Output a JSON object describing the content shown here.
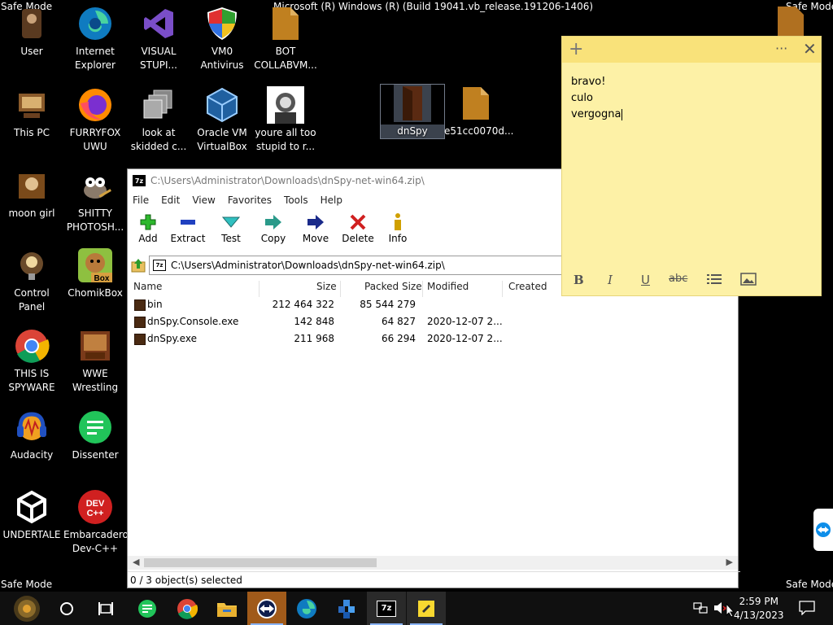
{
  "desktop": {
    "build_text": "Microsoft (R) Windows (R) (Build 19041.vb_release.191206-1406)",
    "safe_mode": "Safe Mode",
    "icons": [
      {
        "label1": "User",
        "label2": ""
      },
      {
        "label1": "Internet",
        "label2": "Explorer"
      },
      {
        "label1": "VISUAL",
        "label2": "STUPI..."
      },
      {
        "label1": "VM0",
        "label2": "Antivirus"
      },
      {
        "label1": "BOT",
        "label2": "COLLABVM..."
      },
      {
        "label1": "This PC",
        "label2": ""
      },
      {
        "label1": "FURRYFOX",
        "label2": "UWU"
      },
      {
        "label1": "look at",
        "label2": "skidded c..."
      },
      {
        "label1": "Oracle VM",
        "label2": "VirtualBox"
      },
      {
        "label1": "youre all too",
        "label2": "stupid to r..."
      },
      {
        "label1": "dnSpy",
        "label2": ""
      },
      {
        "label1": "e51cc0070d...",
        "label2": ""
      },
      {
        "label1": "moon girl",
        "label2": ""
      },
      {
        "label1": "SHITTY",
        "label2": "PHOTOSH..."
      },
      {
        "label1": "Control Panel",
        "label2": ""
      },
      {
        "label1": "ChomikBox",
        "label2": ""
      },
      {
        "label1": "THIS IS",
        "label2": "SPYWARE"
      },
      {
        "label1": "WWE",
        "label2": "Wrestling"
      },
      {
        "label1": "Audacity",
        "label2": ""
      },
      {
        "label1": "Dissenter",
        "label2": ""
      },
      {
        "label1": "UNDERTALE",
        "label2": ""
      },
      {
        "label1": "Embarcadero",
        "label2": "Dev-C++"
      }
    ]
  },
  "zip": {
    "title": "C:\\Users\\Administrator\\Downloads\\dnSpy-net-win64.zip\\",
    "menu": [
      "File",
      "Edit",
      "View",
      "Favorites",
      "Tools",
      "Help"
    ],
    "toolbar": [
      "Add",
      "Extract",
      "Test",
      "Copy",
      "Move",
      "Delete",
      "Info"
    ],
    "address": "C:\\Users\\Administrator\\Downloads\\dnSpy-net-win64.zip\\",
    "columns": {
      "name": "Name",
      "size": "Size",
      "packed": "Packed Size",
      "modified": "Modified",
      "created": "Created"
    },
    "rows": [
      {
        "name": "bin",
        "size": "212 464 322",
        "packed": "85 544 279",
        "modified": ""
      },
      {
        "name": "dnSpy.Console.exe",
        "size": "142 848",
        "packed": "64 827",
        "modified": "2020-12-07 2..."
      },
      {
        "name": "dnSpy.exe",
        "size": "211 968",
        "packed": "66 294",
        "modified": "2020-12-07 2..."
      }
    ],
    "status": "0 / 3 object(s) selected"
  },
  "sticky": {
    "lines": [
      "bravo!",
      "culo",
      "vergogna"
    ],
    "tools": {
      "bold": "B",
      "italic": "I",
      "underline": "U",
      "strike": "abc"
    }
  },
  "clock": {
    "time": "2:59 PM",
    "date": "4/13/2023"
  },
  "badges": {
    "box": "Box",
    "dev": "DEV",
    "devpp": "C++",
    "zip": "7z"
  }
}
